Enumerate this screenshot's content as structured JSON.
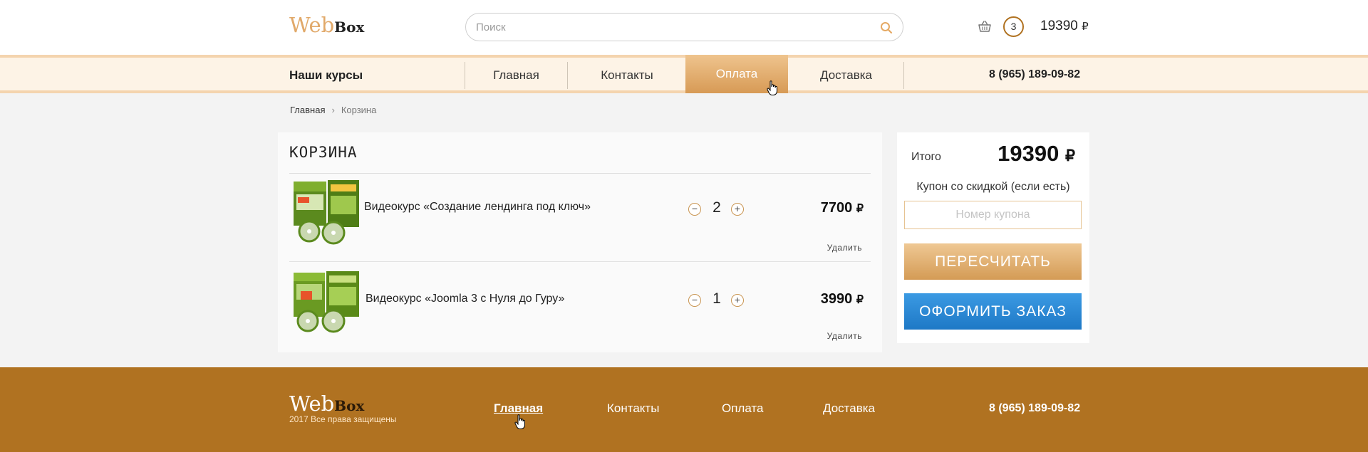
{
  "header": {
    "logo_web": "Web",
    "logo_box": "Box",
    "search_placeholder": "Поиск",
    "cart_count": "3",
    "cart_total": "19390",
    "currency": "₽"
  },
  "nav": {
    "courses_label": "Наши курсы",
    "items": [
      {
        "label": "Главная",
        "active": false
      },
      {
        "label": "Контакты",
        "active": false
      },
      {
        "label": "Оплата",
        "active": true
      },
      {
        "label": "Доставка",
        "active": false
      }
    ],
    "phone": "8 (965) 189-09-82"
  },
  "breadcrumb": {
    "home": "Главная",
    "separator": "›",
    "current": "Корзина"
  },
  "cart": {
    "title": "КОРЗИНА",
    "items": [
      {
        "name": "Видеокурс «Создание лендинга под ключ»",
        "qty": "2",
        "price": "7700",
        "remove_label": "Удалить",
        "minus": "−",
        "plus": "+"
      },
      {
        "name": "Видеокурс «Joomla 3 с Нуля до Гуру»",
        "qty": "1",
        "price": "3990",
        "remove_label": "Удалить",
        "minus": "−",
        "plus": "+"
      }
    ]
  },
  "summary": {
    "total_label": "Итого",
    "total_value": "19390",
    "coupon_label": "Купон со скидкой (если есть)",
    "coupon_placeholder": "Номер купона",
    "recalc_label": "ПЕРЕСЧИТАТЬ",
    "order_label": "ОФОРМИТЬ ЗАКАЗ"
  },
  "footer": {
    "logo_web": "Web",
    "logo_box": "Box",
    "copyright": "2017 Все права защищены",
    "nav": [
      {
        "label": "Главная",
        "active": true
      },
      {
        "label": "Контакты",
        "active": false
      },
      {
        "label": "Оплата",
        "active": false
      },
      {
        "label": "Доставка",
        "active": false
      }
    ],
    "phone": "8 (965) 189-09-82"
  },
  "colors": {
    "accent_orange": "#b07221",
    "nav_active": "#dba262",
    "order_blue": "#2486d3"
  }
}
